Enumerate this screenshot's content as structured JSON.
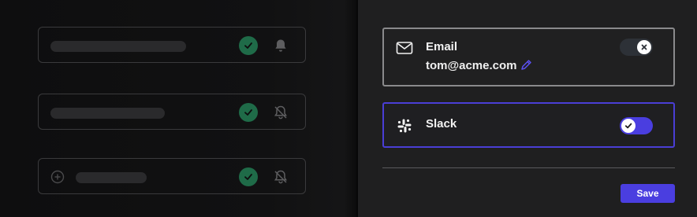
{
  "colors": {
    "accent": "#4a3ee0",
    "success": "#1f6b48",
    "toggle_off": "#2d3137"
  },
  "background_list": {
    "rows": [
      {
        "has_add_icon": false,
        "check_icon": "check-icon",
        "bell_icon": "bell-icon"
      },
      {
        "has_add_icon": false,
        "check_icon": "check-icon",
        "bell_icon": "bell-off-icon"
      },
      {
        "has_add_icon": true,
        "check_icon": "check-icon",
        "bell_icon": "bell-off-icon"
      }
    ]
  },
  "channels": {
    "email": {
      "label": "Email",
      "address": "tom@acme.com",
      "icon": "mail-icon",
      "enabled": false
    },
    "slack": {
      "label": "Slack",
      "icon": "slack-icon",
      "enabled": true
    }
  },
  "footer": {
    "save_label": "Save"
  }
}
